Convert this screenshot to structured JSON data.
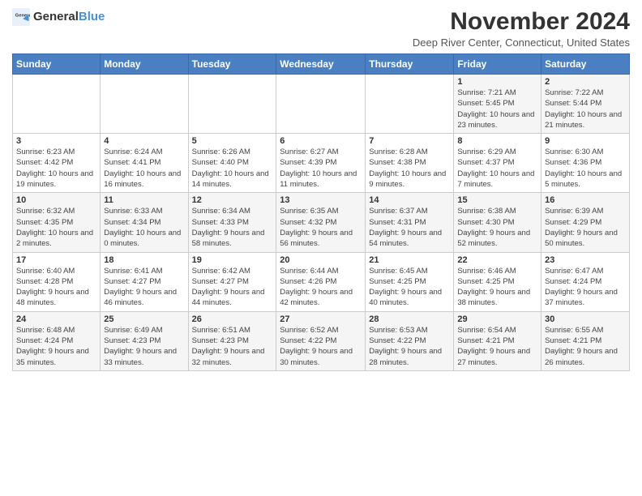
{
  "logo": {
    "text_general": "General",
    "text_blue": "Blue"
  },
  "title": "November 2024",
  "subtitle": "Deep River Center, Connecticut, United States",
  "days_of_week": [
    "Sunday",
    "Monday",
    "Tuesday",
    "Wednesday",
    "Thursday",
    "Friday",
    "Saturday"
  ],
  "weeks": [
    [
      {
        "day": "",
        "info": ""
      },
      {
        "day": "",
        "info": ""
      },
      {
        "day": "",
        "info": ""
      },
      {
        "day": "",
        "info": ""
      },
      {
        "day": "",
        "info": ""
      },
      {
        "day": "1",
        "info": "Sunrise: 7:21 AM\nSunset: 5:45 PM\nDaylight: 10 hours and 23 minutes."
      },
      {
        "day": "2",
        "info": "Sunrise: 7:22 AM\nSunset: 5:44 PM\nDaylight: 10 hours and 21 minutes."
      }
    ],
    [
      {
        "day": "3",
        "info": "Sunrise: 6:23 AM\nSunset: 4:42 PM\nDaylight: 10 hours and 19 minutes."
      },
      {
        "day": "4",
        "info": "Sunrise: 6:24 AM\nSunset: 4:41 PM\nDaylight: 10 hours and 16 minutes."
      },
      {
        "day": "5",
        "info": "Sunrise: 6:26 AM\nSunset: 4:40 PM\nDaylight: 10 hours and 14 minutes."
      },
      {
        "day": "6",
        "info": "Sunrise: 6:27 AM\nSunset: 4:39 PM\nDaylight: 10 hours and 11 minutes."
      },
      {
        "day": "7",
        "info": "Sunrise: 6:28 AM\nSunset: 4:38 PM\nDaylight: 10 hours and 9 minutes."
      },
      {
        "day": "8",
        "info": "Sunrise: 6:29 AM\nSunset: 4:37 PM\nDaylight: 10 hours and 7 minutes."
      },
      {
        "day": "9",
        "info": "Sunrise: 6:30 AM\nSunset: 4:36 PM\nDaylight: 10 hours and 5 minutes."
      }
    ],
    [
      {
        "day": "10",
        "info": "Sunrise: 6:32 AM\nSunset: 4:35 PM\nDaylight: 10 hours and 2 minutes."
      },
      {
        "day": "11",
        "info": "Sunrise: 6:33 AM\nSunset: 4:34 PM\nDaylight: 10 hours and 0 minutes."
      },
      {
        "day": "12",
        "info": "Sunrise: 6:34 AM\nSunset: 4:33 PM\nDaylight: 9 hours and 58 minutes."
      },
      {
        "day": "13",
        "info": "Sunrise: 6:35 AM\nSunset: 4:32 PM\nDaylight: 9 hours and 56 minutes."
      },
      {
        "day": "14",
        "info": "Sunrise: 6:37 AM\nSunset: 4:31 PM\nDaylight: 9 hours and 54 minutes."
      },
      {
        "day": "15",
        "info": "Sunrise: 6:38 AM\nSunset: 4:30 PM\nDaylight: 9 hours and 52 minutes."
      },
      {
        "day": "16",
        "info": "Sunrise: 6:39 AM\nSunset: 4:29 PM\nDaylight: 9 hours and 50 minutes."
      }
    ],
    [
      {
        "day": "17",
        "info": "Sunrise: 6:40 AM\nSunset: 4:28 PM\nDaylight: 9 hours and 48 minutes."
      },
      {
        "day": "18",
        "info": "Sunrise: 6:41 AM\nSunset: 4:27 PM\nDaylight: 9 hours and 46 minutes."
      },
      {
        "day": "19",
        "info": "Sunrise: 6:42 AM\nSunset: 4:27 PM\nDaylight: 9 hours and 44 minutes."
      },
      {
        "day": "20",
        "info": "Sunrise: 6:44 AM\nSunset: 4:26 PM\nDaylight: 9 hours and 42 minutes."
      },
      {
        "day": "21",
        "info": "Sunrise: 6:45 AM\nSunset: 4:25 PM\nDaylight: 9 hours and 40 minutes."
      },
      {
        "day": "22",
        "info": "Sunrise: 6:46 AM\nSunset: 4:25 PM\nDaylight: 9 hours and 38 minutes."
      },
      {
        "day": "23",
        "info": "Sunrise: 6:47 AM\nSunset: 4:24 PM\nDaylight: 9 hours and 37 minutes."
      }
    ],
    [
      {
        "day": "24",
        "info": "Sunrise: 6:48 AM\nSunset: 4:24 PM\nDaylight: 9 hours and 35 minutes."
      },
      {
        "day": "25",
        "info": "Sunrise: 6:49 AM\nSunset: 4:23 PM\nDaylight: 9 hours and 33 minutes."
      },
      {
        "day": "26",
        "info": "Sunrise: 6:51 AM\nSunset: 4:23 PM\nDaylight: 9 hours and 32 minutes."
      },
      {
        "day": "27",
        "info": "Sunrise: 6:52 AM\nSunset: 4:22 PM\nDaylight: 9 hours and 30 minutes."
      },
      {
        "day": "28",
        "info": "Sunrise: 6:53 AM\nSunset: 4:22 PM\nDaylight: 9 hours and 28 minutes."
      },
      {
        "day": "29",
        "info": "Sunrise: 6:54 AM\nSunset: 4:21 PM\nDaylight: 9 hours and 27 minutes."
      },
      {
        "day": "30",
        "info": "Sunrise: 6:55 AM\nSunset: 4:21 PM\nDaylight: 9 hours and 26 minutes."
      }
    ]
  ]
}
